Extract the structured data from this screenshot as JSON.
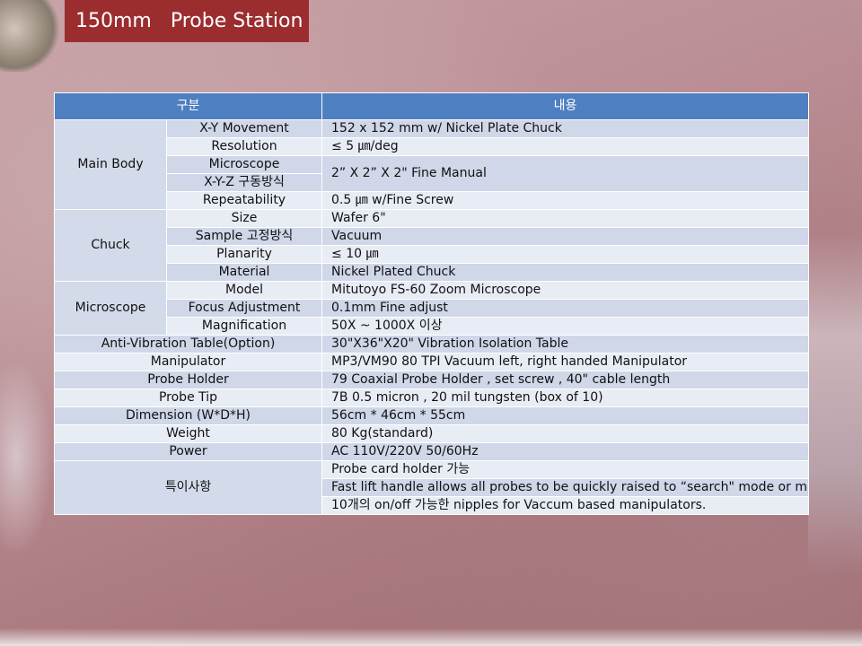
{
  "title": "150mm   Probe Station",
  "table": {
    "headers": [
      "구분",
      "내용"
    ],
    "main_body": {
      "label": "Main Body",
      "rows": [
        {
          "item": "X-Y Movement",
          "value": "152 x 152 mm w/ Nickel Plate Chuck"
        },
        {
          "item": "Resolution",
          "value": "≤ 5 ㎛/deg"
        },
        {
          "item": "Microscope",
          "value": "2” X 2” X 2\" Fine Manual"
        },
        {
          "item": "X-Y-Z 구동방식"
        },
        {
          "item": "Repeatability",
          "value": "0.5 ㎛ w/Fine Screw"
        }
      ]
    },
    "chuck": {
      "label": "Chuck",
      "rows": [
        {
          "item": "Size",
          "value": "Wafer 6\""
        },
        {
          "item": "Sample 고정방식",
          "value": "Vacuum"
        },
        {
          "item": "Planarity",
          "value": "≤ 10 ㎛"
        },
        {
          "item": "Material",
          "value": "Nickel Plated Chuck"
        }
      ]
    },
    "microscope": {
      "label": "Microscope",
      "rows": [
        {
          "item": "Model",
          "value": "Mitutoyo FS-60 Zoom Microscope"
        },
        {
          "item": "Focus Adjustment",
          "value": "0.1mm Fine adjust"
        },
        {
          "item": "Magnification",
          "value": "50X ~ 1000X 이상"
        }
      ]
    },
    "simple_rows": [
      {
        "item": "Anti-Vibration Table(Option)",
        "value": "30\"X36\"X20\" Vibration Isolation Table"
      },
      {
        "item": "Manipulator",
        "value": "MP3/VM90 80 TPI Vacuum  left, right handed Manipulator"
      },
      {
        "item": "Probe Holder",
        "value": "79 Coaxial Probe Holder , set screw , 40\" cable length"
      },
      {
        "item": "Probe Tip",
        "value": "7B 0.5 micron , 20 mil tungsten (box of 10)"
      },
      {
        "item": "Dimension (W*D*H)",
        "value": "56cm * 46cm * 55cm"
      },
      {
        "item": "Weight",
        "value": "80 Kg(standard)"
      },
      {
        "item": "Power",
        "value": "AC 110V/220V 50/60Hz"
      }
    ],
    "special": {
      "label": "특이사항",
      "rows": [
        "Probe card holder 가능",
        "Fast lift handle allows all probes to be quickly raised to “search\" mode or microscope and probes to be automatically raised a large amount with three locking \"up\" positions",
        "10개의 on/off 가능한 nipples for Vaccum based manipulators."
      ]
    }
  }
}
